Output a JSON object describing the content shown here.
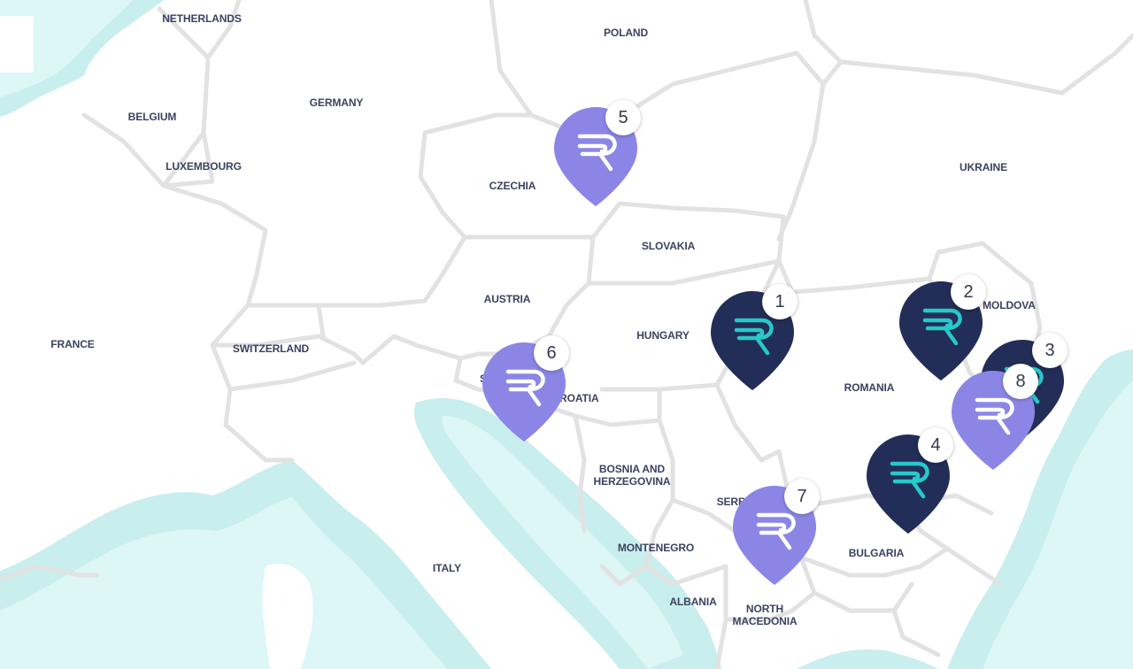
{
  "colors": {
    "land": "#ffffff",
    "border": "#e2e2e2",
    "water": "#c9eeee",
    "water_deep": "#ddf6f6",
    "label": "#3c4260",
    "marker_dark": "#232e58",
    "marker_dark_logo": "#27c9c9",
    "marker_light": "#8b86e6",
    "marker_light_logo": "#ffffff",
    "badge_bg": "#ffffff",
    "badge_text": "#333a4d"
  },
  "map": {
    "countries": [
      {
        "id": "netherlands",
        "name": "NETHERLANDS"
      },
      {
        "id": "poland",
        "name": "POLAND"
      },
      {
        "id": "belgium",
        "name": "BELGIUM"
      },
      {
        "id": "germany",
        "name": "GERMANY"
      },
      {
        "id": "luxembourg",
        "name": "LUXEMBOURG"
      },
      {
        "id": "ukraine",
        "name": "UKRAINE"
      },
      {
        "id": "czechia",
        "name": "CZECHIA"
      },
      {
        "id": "slovakia",
        "name": "SLOVAKIA"
      },
      {
        "id": "austria",
        "name": "AUSTRIA"
      },
      {
        "id": "moldova",
        "name": "MOLDOVA"
      },
      {
        "id": "france",
        "name": "FRANCE"
      },
      {
        "id": "switzerland",
        "name": "SWITZERLAND"
      },
      {
        "id": "hungary",
        "name": "HUNGARY"
      },
      {
        "id": "romania",
        "name": "ROMANIA"
      },
      {
        "id": "slovenia",
        "name": "S"
      },
      {
        "id": "croatia",
        "name": "CROATIA"
      },
      {
        "id": "bosnia",
        "name": "BOSNIA AND",
        "name2": "HERZEGOVINA"
      },
      {
        "id": "serbia",
        "name": "SERBIA"
      },
      {
        "id": "montenegro",
        "name": "MONTENEGRO"
      },
      {
        "id": "bulgaria",
        "name": "BULGARIA"
      },
      {
        "id": "italy",
        "name": "ITALY"
      },
      {
        "id": "albania",
        "name": "ALBANIA"
      },
      {
        "id": "north-macedonia",
        "name": "NORTH",
        "name2": "MACEDONIA"
      }
    ],
    "markers": [
      {
        "number": "5",
        "style": "light",
        "logo": "R"
      },
      {
        "number": "1",
        "style": "dark",
        "logo": "R"
      },
      {
        "number": "2",
        "style": "dark",
        "logo": "R"
      },
      {
        "number": "6",
        "style": "light",
        "logo": "R"
      },
      {
        "number": "3",
        "style": "dark",
        "logo": "R"
      },
      {
        "number": "8",
        "style": "light",
        "logo": "R"
      },
      {
        "number": "4",
        "style": "dark",
        "logo": "R"
      },
      {
        "number": "7",
        "style": "light",
        "logo": "R"
      }
    ]
  }
}
